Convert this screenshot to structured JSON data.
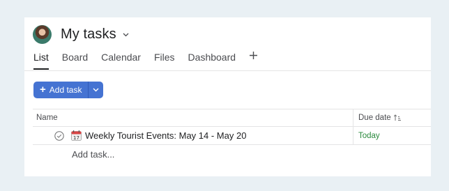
{
  "project": {
    "title": "My tasks"
  },
  "tabs": [
    {
      "label": "List",
      "active": true
    },
    {
      "label": "Board",
      "active": false
    },
    {
      "label": "Calendar",
      "active": false
    },
    {
      "label": "Files",
      "active": false
    },
    {
      "label": "Dashboard",
      "active": false
    }
  ],
  "tab_add_icon": "plus-icon",
  "toolbar": {
    "add_task_label": "Add task",
    "add_task_icon": "plus-icon",
    "dropdown_icon": "chevron-down-icon",
    "accent_color": "#4573d2"
  },
  "table": {
    "columns": {
      "name": "Name",
      "due": "Due date"
    },
    "rows": [
      {
        "icon": "calendar-emoji-icon",
        "title": "Weekly Tourist Events: May 14 - May 20",
        "due": "Today",
        "due_color": "#2b8a3e"
      }
    ],
    "add_task_placeholder": "Add task..."
  }
}
